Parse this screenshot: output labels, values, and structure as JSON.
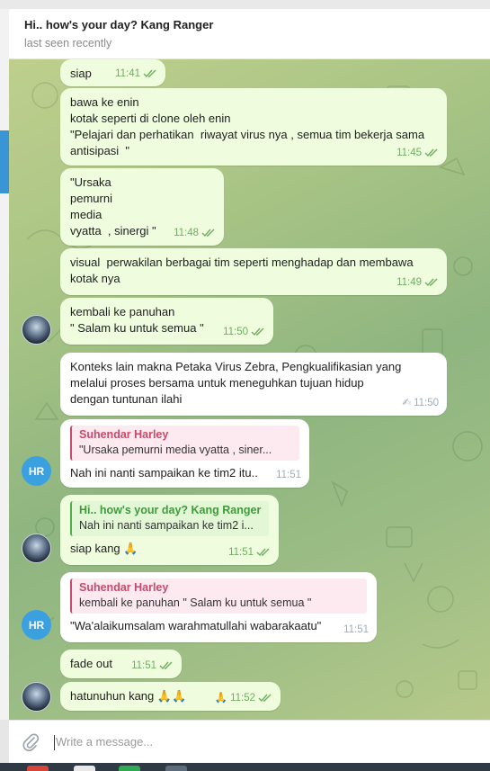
{
  "header": {
    "title": "Hi.. how's your day? Kang Ranger",
    "status": "last seen recently"
  },
  "messages": [
    {
      "text": "siap",
      "time": "11:41"
    },
    {
      "text": "bawa ke enin\nkotak seperti di clone oleh enin\n\"Pelajari dan perhatikan  riwayat virus nya , semua tim bekerja sama antisipasi  \"",
      "time": "11:45"
    },
    {
      "text": "\"Ursaka\npemurni\nmedia\nvyatta  , sinergi \"",
      "time": "11:48"
    },
    {
      "text": "visual  perwakilan berbagai tim seperti menghadap dan membawa kotak nya",
      "time": "11:49"
    },
    {
      "text": "kembali ke panuhan\n\" Salam ku untuk semua \"",
      "time": "11:50"
    },
    {
      "text": "Konteks lain makna Petaka Virus Zebra, Pengkualifikasian yang melalui proses bersama untuk meneguhkan tujuan hidup dengan tuntunan ilahi",
      "time": "11:50",
      "pencil": "✍"
    },
    {
      "reply_name": "Suhendar Harley",
      "reply_text": "\"Ursaka  pemurni  media  vyatta  , siner...",
      "text": "Nah ini nanti sampaikan ke tim2 itu..",
      "time": "11:51"
    },
    {
      "reply_name": "Hi.. how's your day? Kang Ranger",
      "reply_text": "Nah ini nanti sampaikan ke tim2 i...",
      "text": "siap kang 🙏",
      "time": "11:51"
    },
    {
      "reply_name": "Suhendar Harley",
      "reply_text": "kembali ke panuhan  \" Salam ku untuk semua \"",
      "text": "\"Wa'alaikumsalam warahmatullahi wabarakaatu\"",
      "time": "11:51"
    },
    {
      "text": "fade out",
      "time": "11:51"
    },
    {
      "text": "hatunuhun kang 🙏🙏",
      "time": "11:52",
      "reaction": "🙏"
    }
  ],
  "avatars": {
    "hr": "HR"
  },
  "composer": {
    "placeholder": "Write a message..."
  },
  "icons": {
    "attach": "paperclip-icon",
    "ticks": "double-check-icon",
    "edited": "pencil-icon"
  },
  "colors": {
    "outgoing": "#effdde",
    "incoming": "#ffffff",
    "reply_pink": "#c74b6b",
    "reply_green": "#3f9b3c",
    "tick": "#6fae60",
    "accent": "#3a95d6"
  }
}
